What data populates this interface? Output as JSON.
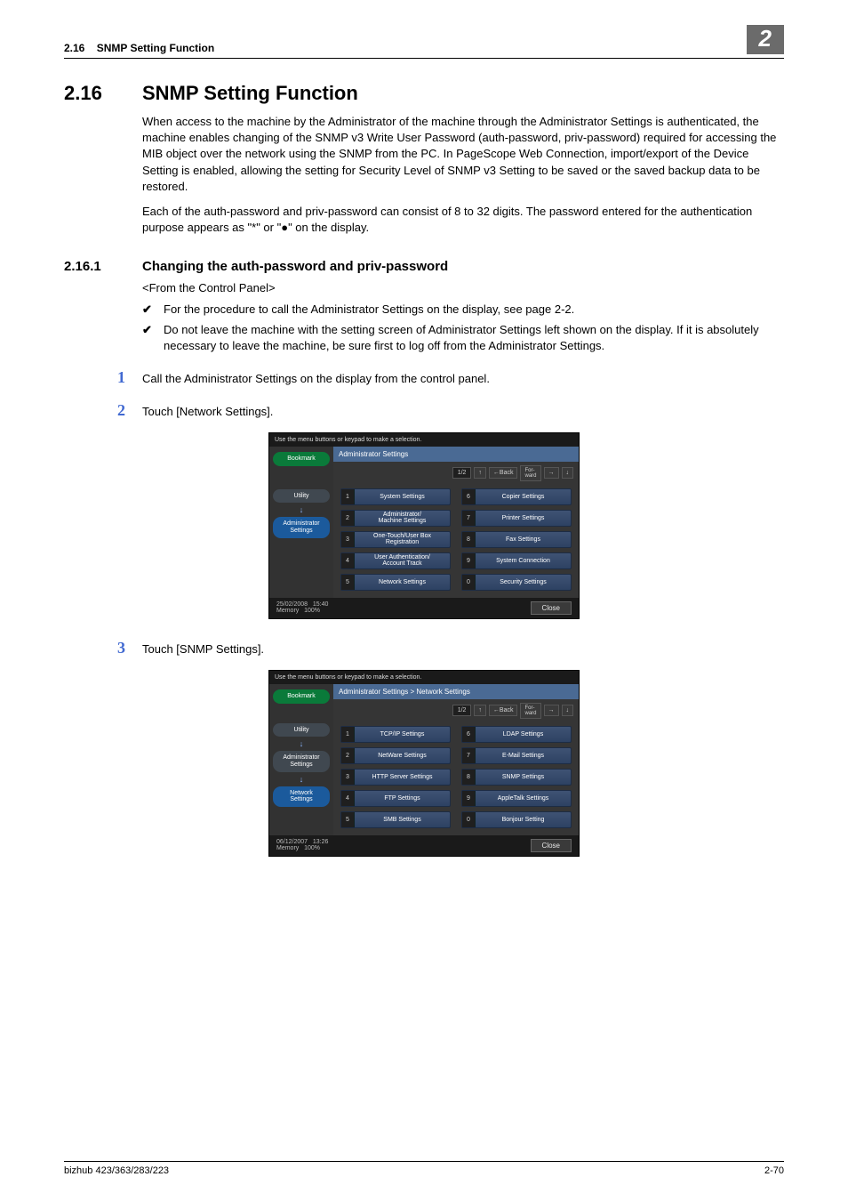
{
  "header": {
    "section_ref": "2.16",
    "section_name": "SNMP Setting Function",
    "chapter_badge": "2"
  },
  "h1": {
    "num": "2.16",
    "txt": "SNMP Setting Function"
  },
  "para1": "When access to the machine by the Administrator of the machine through the Administrator Settings is authenticated, the machine enables changing of the SNMP v3 Write User Password (auth-password, priv-password) required for accessing the MIB object over the network using the SNMP from the PC. In PageScope Web Connection, import/export of the Device Setting is enabled, allowing the setting for Security Level of SNMP v3 Setting to be saved or the saved backup data to be restored.",
  "para2_a": "Each of the auth-password and priv-password can consist of 8 to 32 digits. The password entered for the authentication purpose appears as \"*\" or \"",
  "para2_b": "\" on the display.",
  "h2": {
    "num": "2.16.1",
    "txt": "Changing the auth-password and priv-password"
  },
  "sub": "<From the Control Panel>",
  "checks": [
    "For the procedure to call the Administrator Settings on the display, see page 2-2.",
    "Do not leave the machine with the setting screen of Administrator Settings left shown on the display. If it is absolutely necessary to leave the machine, be sure first to log off from the Administrator Settings."
  ],
  "steps": {
    "s1": {
      "num": "1",
      "txt": "Call the Administrator Settings on the display from the control panel."
    },
    "s2": {
      "num": "2",
      "txt": "Touch [Network Settings]."
    },
    "s3": {
      "num": "3",
      "txt": "Touch [SNMP Settings]."
    }
  },
  "common": {
    "instruction": "Use the menu buttons or keypad to make a selection.",
    "pager": "1/2",
    "back": "←Back",
    "fwd": "For-\nward",
    "close": "Close",
    "memory": "Memory",
    "mempct": "100%"
  },
  "shot1": {
    "side": {
      "bookmark": "Bookmark",
      "utility": "Utility",
      "admin": "Administrator\nSettings"
    },
    "title": "Administrator Settings",
    "items": [
      {
        "n": "1",
        "l": "System Settings"
      },
      {
        "n": "6",
        "l": "Copier Settings"
      },
      {
        "n": "2",
        "l": "Administrator/\nMachine Settings"
      },
      {
        "n": "7",
        "l": "Printer Settings"
      },
      {
        "n": "3",
        "l": "One-Touch/User Box\nRegistration"
      },
      {
        "n": "8",
        "l": "Fax Settings"
      },
      {
        "n": "4",
        "l": "User Authentication/\nAccount Track"
      },
      {
        "n": "9",
        "l": "System Connection"
      },
      {
        "n": "5",
        "l": "Network Settings"
      },
      {
        "n": "0",
        "l": "Security Settings"
      }
    ],
    "date": "25/02/2008",
    "time": "15:40"
  },
  "shot2": {
    "side": {
      "bookmark": "Bookmark",
      "utility": "Utility",
      "admin": "Administrator\nSettings",
      "network": "Network\nSettings"
    },
    "title": "Administrator Settings > Network Settings",
    "items": [
      {
        "n": "1",
        "l": "TCP/IP Settings"
      },
      {
        "n": "6",
        "l": "LDAP Settings"
      },
      {
        "n": "2",
        "l": "NetWare Settings"
      },
      {
        "n": "7",
        "l": "E-Mail Settings"
      },
      {
        "n": "3",
        "l": "HTTP Server Settings"
      },
      {
        "n": "8",
        "l": "SNMP Settings"
      },
      {
        "n": "4",
        "l": "FTP Settings"
      },
      {
        "n": "9",
        "l": "AppleTalk Settings"
      },
      {
        "n": "5",
        "l": "SMB Settings"
      },
      {
        "n": "0",
        "l": "Bonjour Setting"
      }
    ],
    "date": "06/12/2007",
    "time": "13:26"
  },
  "footer": {
    "model": "bizhub 423/363/283/223",
    "page": "2-70"
  }
}
